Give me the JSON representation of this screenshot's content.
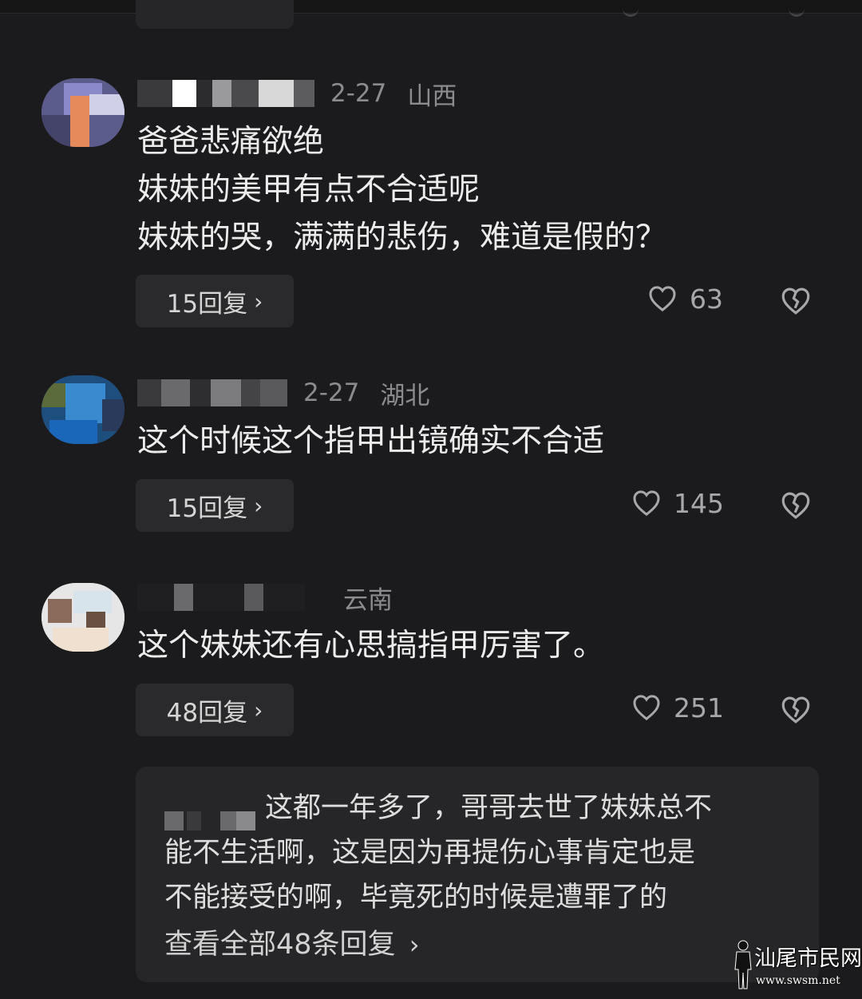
{
  "comments": [
    {
      "date": "2-27",
      "location": "山西",
      "lines": [
        "爸爸悲痛欲绝",
        "妹妹的美甲有点不合适呢",
        "妹妹的哭，满满的悲伤，难道是假的？"
      ],
      "reply_label": "15回复",
      "likes": "63"
    },
    {
      "date": "2-27",
      "location": "湖北",
      "lines": [
        "这个时候这个指甲出镜确实不合适"
      ],
      "reply_label": "15回复",
      "likes": "145"
    },
    {
      "date": "",
      "location": "云南",
      "lines": [
        "这个妹妹还有心思搞指甲厉害了。"
      ],
      "reply_label": "48回复",
      "likes": "251"
    }
  ],
  "reply_preview": {
    "lines": [
      "这都一年多了，哥哥去世了妹妹总不",
      "能不生活啊，这是因为再提伤心事肯定也是",
      "不能接受的啊，毕竟死的时候是遭罪了的"
    ],
    "view_all": "查看全部48条回复"
  },
  "icons": {
    "chevron": "chevron-right-icon",
    "like": "heart-icon",
    "dislike": "broken-heart-icon"
  },
  "watermark": {
    "name": "汕尾市民网",
    "url": "www.swsm.net"
  },
  "colors": {
    "background": "#1b1b1d",
    "button": "#2a2a2c",
    "text": "#ececec",
    "muted": "#8c8c8f"
  }
}
